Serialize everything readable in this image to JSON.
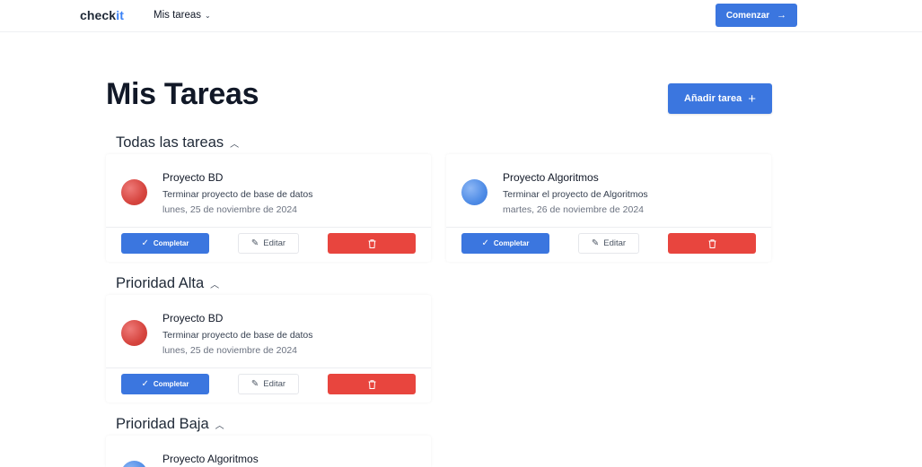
{
  "nav": {
    "logo_main": "check",
    "logo_accent": "it",
    "menu_label": "Mis tareas",
    "start_button": "Comenzar"
  },
  "page": {
    "title": "Mis Tareas",
    "add_button": "Añadir tarea"
  },
  "sections": [
    {
      "label": "Todas las tareas",
      "cards": [
        {
          "title": "Proyecto BD",
          "description": "Terminar proyecto de base de datos",
          "date": "lunes, 25 de noviembre de 2024",
          "color": "red",
          "complete_label": "Completar",
          "edit_label": "Editar"
        },
        {
          "title": "Proyecto Algoritmos",
          "description": "Terminar el proyecto de Algoritmos",
          "date": "martes, 26 de noviembre de 2024",
          "color": "blue",
          "complete_label": "Completar",
          "edit_label": "Editar"
        }
      ]
    },
    {
      "label": "Prioridad Alta",
      "cards": [
        {
          "title": "Proyecto BD",
          "description": "Terminar proyecto de base de datos",
          "date": "lunes, 25 de noviembre de 2024",
          "color": "red",
          "complete_label": "Completar",
          "edit_label": "Editar"
        }
      ]
    },
    {
      "label": "Prioridad Baja",
      "cards": [
        {
          "title": "Proyecto Algoritmos",
          "color": "blue"
        }
      ]
    }
  ],
  "colors": {
    "primary": "#3b76df",
    "danger": "#e8453e",
    "priority_high": "#d6453f",
    "priority_low": "#4f8ce6"
  }
}
